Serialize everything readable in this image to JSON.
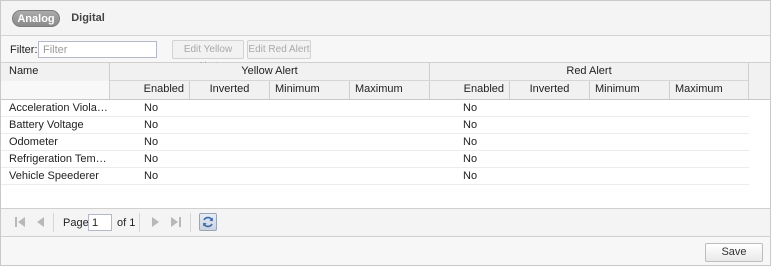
{
  "tabs": {
    "analog": "Analog",
    "digital": "Digital"
  },
  "toolbar": {
    "filter_label": "Filter:",
    "filter_placeholder": "Filter",
    "filter_value": "",
    "edit_yellow": "Edit Yellow Alert",
    "edit_red": "Edit Red Alert"
  },
  "grid": {
    "columns": {
      "name": "Name",
      "yellow_group": "Yellow Alert",
      "red_group": "Red Alert",
      "yellow": [
        "Enabled",
        "Inverted",
        "Minimum",
        "Maximum"
      ],
      "red": [
        "Enabled",
        "Inverted",
        "Minimum",
        "Maximum"
      ]
    },
    "rows": [
      {
        "name": "Acceleration Violations",
        "yellow_enabled": "No",
        "red_enabled": "No"
      },
      {
        "name": "Battery Voltage",
        "yellow_enabled": "No",
        "red_enabled": "No"
      },
      {
        "name": "Odometer",
        "yellow_enabled": "No",
        "red_enabled": "No"
      },
      {
        "name": "Refrigeration Tempera...",
        "yellow_enabled": "No",
        "red_enabled": "No"
      },
      {
        "name": "Vehicle Speederer",
        "yellow_enabled": "No",
        "red_enabled": "No"
      }
    ]
  },
  "pager": {
    "page_label": "Page",
    "page_value": "1",
    "of_label": "of 1"
  },
  "footer": {
    "save_label": "Save"
  }
}
